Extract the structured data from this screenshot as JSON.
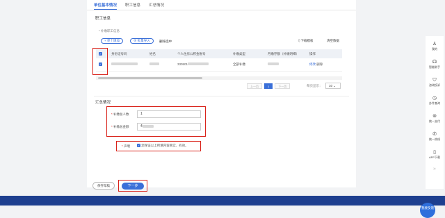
{
  "tabs": [
    "单位基本情况",
    "职工信息",
    "汇总情况"
  ],
  "section_workers": "职工信息",
  "sub_workers": "* 补缴职工信息",
  "toolbar": {
    "add": "+ 单个增加",
    "batch": "批量导入",
    "delete": "删除选中",
    "download": "下载模板",
    "clear": "清空数据"
  },
  "table": {
    "headers": [
      "身份证号码",
      "姓名",
      "个人住房公积金账号",
      "补缴类型",
      "月缴存额（补缴明细）",
      "操作"
    ],
    "row": {
      "account": "330501",
      "type": "全部补缴",
      "modify": "修改",
      "remove": "删除"
    }
  },
  "pager": {
    "prev": "上一页",
    "page": "1",
    "next": "下一页",
    "show_label": "每页显示：",
    "per_page": "10"
  },
  "section_summary": "汇总情况",
  "fields": {
    "count_label": "补缴总人数",
    "count_value": "1",
    "amount_label": "补缴总金额",
    "amount_value": "4"
  },
  "declaration": {
    "label": "声明",
    "text": "您保证以上所填内容真实、有效。"
  },
  "buttons": {
    "save_draft": "保存草稿",
    "next": "下一步"
  },
  "rail": [
    "我的",
    "智能助手",
    "咨询投诉",
    "办件查询",
    "统一支付",
    "统一热线",
    "APP下载"
  ],
  "feedback": "我要反馈",
  "colors": {
    "primary": "#3a6fd8",
    "highlight": "#d9231b",
    "footer": "#1e3f8f"
  }
}
